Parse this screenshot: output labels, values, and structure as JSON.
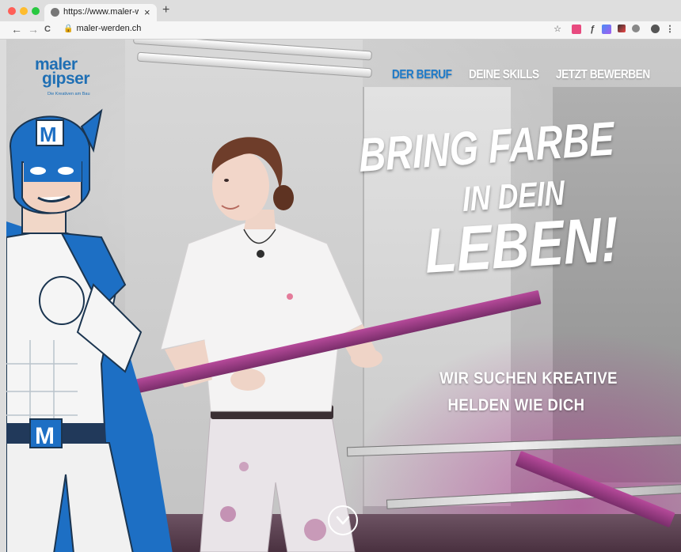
{
  "browser": {
    "tab_title": "https://www.maler-werden.ch",
    "tab_close": "×",
    "new_tab": "+",
    "url": "maler-werden.ch",
    "back_icon": "←",
    "forward_icon": "→",
    "reload_icon": "C",
    "lock_icon": "🔒",
    "star_icon": "☆",
    "menu_icon": "⋮",
    "traffic_colors": [
      "#ff5f57",
      "#febc2e",
      "#28c840"
    ]
  },
  "logo": {
    "line1": "maler",
    "line2": "gipser",
    "tagline": "Die Kreativen am Bau"
  },
  "nav": {
    "items": [
      {
        "label": "DER BERUF",
        "color": "#1f7bc9",
        "active": true
      },
      {
        "label": "DEINE SKILLS",
        "color": "#ffffff",
        "active": false
      },
      {
        "label": "JETZT BEWERBEN",
        "color": "#ffffff",
        "active": false
      }
    ]
  },
  "hero": {
    "line1": "BRING FARBE",
    "line2": "IN DEIN",
    "line3": "LEBEN!",
    "sub1": "WIR SUCHEN KREATIVE",
    "sub2": "HELDEN WIE DICH",
    "badge_letter": "M",
    "belt_letter": "M"
  },
  "colors": {
    "brand_blue": "#1f6fb4",
    "accent_pink": "#b03f8f"
  }
}
